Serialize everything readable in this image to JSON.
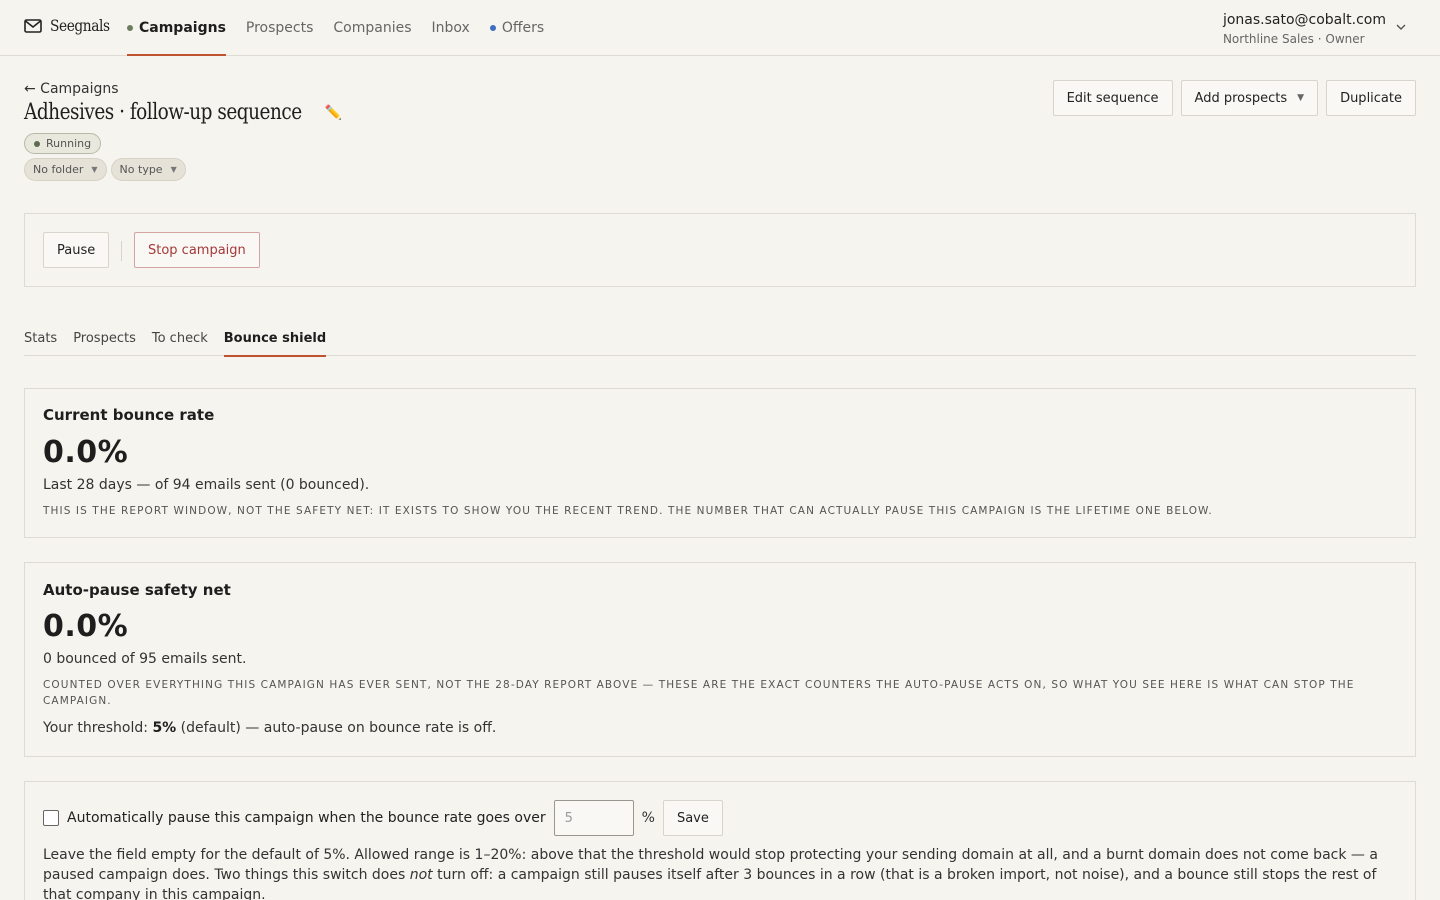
{
  "brand": {
    "name": "Seegnals"
  },
  "nav": {
    "items": [
      {
        "label": "Campaigns",
        "dot": "green",
        "active": true
      },
      {
        "label": "Prospects"
      },
      {
        "label": "Companies"
      },
      {
        "label": "Inbox"
      },
      {
        "label": "Offers",
        "dot": "blue"
      }
    ]
  },
  "account": {
    "email": "jonas.sato@cobalt.com",
    "org": "Northline Sales · Owner"
  },
  "header": {
    "back_label": "← Campaigns",
    "title": "Adhesives · follow-up sequence",
    "status": "Running",
    "folder": "No folder",
    "type": "No type",
    "actions": {
      "edit": "Edit sequence",
      "add_prospects": "Add prospects",
      "duplicate": "Duplicate"
    }
  },
  "controls": {
    "pause": "Pause",
    "stop": "Stop campaign"
  },
  "tabs": [
    "Stats",
    "Prospects",
    "To check",
    "Bounce shield"
  ],
  "current_bounce": {
    "title": "Current bounce rate",
    "value": "0.0%",
    "sub": "Last 28 days — of 94 emails sent (0 bounced).",
    "note": "This is the report window, not the safety net: it exists to show you the recent trend. The number that can actually pause this campaign is the lifetime one below."
  },
  "safety_net": {
    "title": "Auto-pause safety net",
    "value": "0.0%",
    "sub": "0 bounced of 95 emails sent.",
    "note": "Counted over everything this campaign has ever sent, not the 28-day report above — these are the exact counters the auto-pause acts on, so what you see here is what can stop the campaign.",
    "threshold_prefix": "Your threshold: ",
    "threshold_value": "5%",
    "threshold_suffix": " (default) — auto-pause on bounce rate is off."
  },
  "auto_pause": {
    "label": "Automatically pause this campaign when the bounce rate goes over",
    "placeholder": "5",
    "unit": "%",
    "save": "Save",
    "help_1": "Leave the field empty for the default of 5%. Allowed range is 1–20%: above that the threshold would stop protecting your sending domain at all, and a burnt domain does not come back — a paused campaign does. Two things this switch does ",
    "help_em": "not",
    "help_2": " turn off: a campaign still pauses itself after 3 bounces in a row (that is a broken import, not noise), and a bounce still stops the rest of that company in this campaign."
  }
}
